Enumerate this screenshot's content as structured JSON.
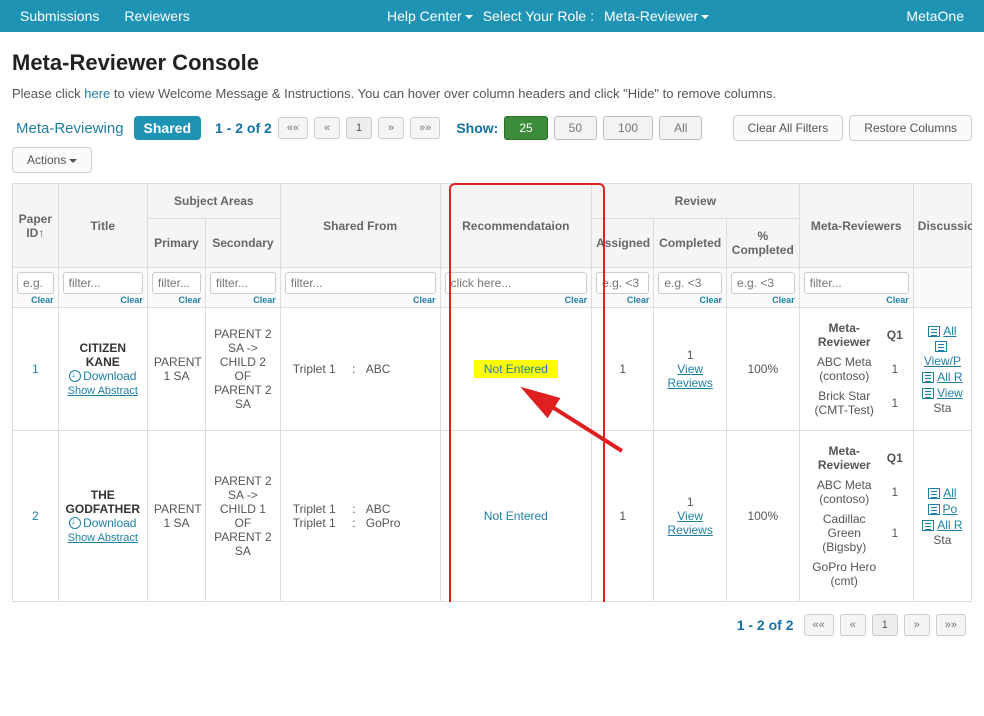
{
  "topbar": {
    "submissions": "Submissions",
    "reviewers": "Reviewers",
    "help_center": "Help Center",
    "select_role_label": "Select Your Role :",
    "current_role": "Meta-Reviewer",
    "user": "MetaOne"
  },
  "page": {
    "title": "Meta-Reviewer Console",
    "instructions_pre": "Please click ",
    "instructions_link": "here",
    "instructions_post": " to view Welcome Message & Instructions. You can hover over column headers and click \"Hide\" to remove columns."
  },
  "tabs": {
    "meta_reviewing": "Meta-Reviewing",
    "shared": "Shared"
  },
  "pager": {
    "count": "1 - 2 of 2",
    "first": "««",
    "prev": "«",
    "page": "1",
    "next": "»",
    "last": "»»"
  },
  "show": {
    "label": "Show:",
    "s25": "25",
    "s50": "50",
    "s100": "100",
    "sAll": "All"
  },
  "buttons": {
    "clear_filters": "Clear All Filters",
    "restore_cols": "Restore Columns",
    "actions": "Actions"
  },
  "headers": {
    "paper_id": "Paper ID",
    "title": "Title",
    "subject_areas": "Subject Areas",
    "primary": "Primary",
    "secondary": "Secondary",
    "shared_from": "Shared From",
    "recommendation": "Recommendataion",
    "review": "Review",
    "assigned": "Assigned",
    "completed": "Completed",
    "pct_completed": "% Completed",
    "meta_reviewers": "Meta-Reviewers",
    "discussion": "Discussion"
  },
  "filters": {
    "eg": "e.g.",
    "filter": "filter...",
    "click_here": "click here...",
    "eg_lt3": "e.g. <3",
    "clear": "Clear"
  },
  "mr_sub": {
    "header": "Meta-Reviewer",
    "q1": "Q1"
  },
  "rows": [
    {
      "id": "1",
      "title": "CITIZEN KANE",
      "download": "Download",
      "abstract": "Show Abstract",
      "primary": "PARENT 1 SA",
      "secondary": "PARENT 2 SA -> CHILD 2 OF PARENT 2 SA",
      "shared": [
        [
          "Triplet 1",
          ":",
          "ABC"
        ]
      ],
      "rec": "Not Entered",
      "rec_highlight": true,
      "assigned": "1",
      "completed_n": "1",
      "view_reviews": "View Reviews",
      "pct": "100%",
      "reviewers": [
        {
          "name": "ABC Meta (contoso)",
          "q1": "1"
        },
        {
          "name": "Brick Star (CMT-Test)",
          "q1": "1"
        }
      ],
      "discuss": [
        "All",
        "View/P",
        "All R",
        "View"
      ],
      "stats": "Sta"
    },
    {
      "id": "2",
      "title": "THE GODFATHER",
      "download": "Download",
      "abstract": "Show Abstract",
      "primary": "PARENT 1 SA",
      "secondary": "PARENT 2 SA -> CHILD 1 OF PARENT 2 SA",
      "shared": [
        [
          "Triplet 1",
          ":",
          "ABC"
        ],
        [
          "Triplet 1",
          ":",
          "GoPro"
        ]
      ],
      "rec": "Not Entered",
      "rec_highlight": false,
      "assigned": "1",
      "completed_n": "1",
      "view_reviews": "View Reviews",
      "pct": "100%",
      "reviewers": [
        {
          "name": "ABC Meta (contoso)",
          "q1": "1"
        },
        {
          "name": "Cadillac Green (Bigsby)",
          "q1": "1"
        },
        {
          "name": "GoPro Hero (cmt)",
          "q1": ""
        }
      ],
      "discuss": [
        "All",
        "Po",
        "All R"
      ],
      "stats": "Sta"
    }
  ]
}
